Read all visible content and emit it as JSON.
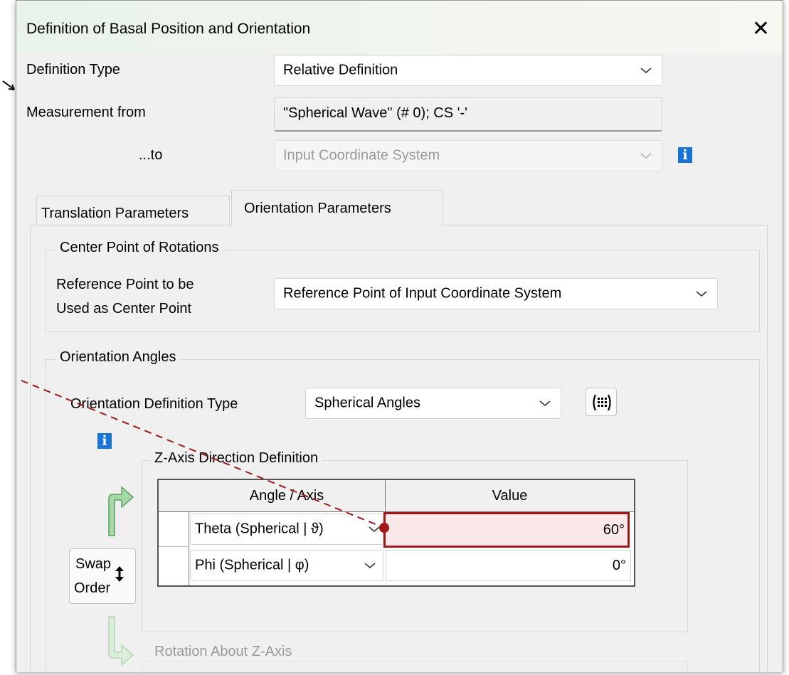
{
  "dialog": {
    "title": "Definition of Basal Position and Orientation",
    "close_symbol": "✕"
  },
  "fields": {
    "definition_type_label": "Definition Type",
    "definition_type_value": "Relative Definition",
    "measurement_from_label": "Measurement from",
    "measurement_from_value": "\"Spherical Wave\" (# 0); CS '-'",
    "to_label": "...to",
    "to_value": "Input Coordinate System"
  },
  "tabs": [
    {
      "label": "Translation Parameters",
      "active": false
    },
    {
      "label": "Orientation Parameters",
      "active": true
    }
  ],
  "center_point": {
    "legend": "Center Point of Rotations",
    "label_line1": "Reference Point to be",
    "label_line2": "Used as Center Point",
    "value": "Reference Point of Input Coordinate System"
  },
  "orientation": {
    "legend": "Orientation Angles",
    "def_type_label": "Orientation Definition Type",
    "def_type_value": "Spherical Angles"
  },
  "z_axis": {
    "legend": "Z-Axis Direction Definition",
    "columns": [
      "Angle / Axis",
      "Value"
    ],
    "rows": [
      {
        "angle": "Theta (Spherical | ϑ)",
        "value": "60°",
        "highlighted": true
      },
      {
        "angle": "Phi (Spherical | φ)",
        "value": "0°",
        "highlighted": false
      }
    ]
  },
  "swap_button": {
    "line1": "Swap",
    "line2": "Order"
  },
  "rotation_about_z": {
    "legend": "Rotation About Z-Axis"
  },
  "colors": {
    "highlight_border": "#a01818",
    "highlight_fill": "#fbe8e8",
    "info_blue": "#1874d8",
    "arrow_green": "#7bbd7b"
  },
  "icons": [
    "close-icon",
    "chevron-down-icon",
    "info-icon",
    "table-keypad-icon",
    "arrow-up-right-icon",
    "arrow-down-right-icon",
    "swap-updown-icon"
  ]
}
